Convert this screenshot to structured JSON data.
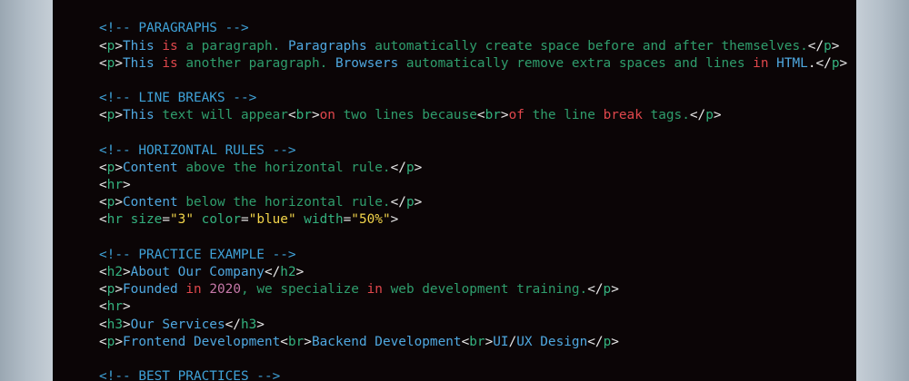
{
  "editor": {
    "lines": [
      [
        [
          "c-txt",
          "    "
        ]
      ],
      [],
      [
        [
          "c-comment",
          "<!-- PARAGRAPHS -->"
        ]
      ],
      [
        [
          "c-tag",
          "<"
        ],
        [
          "c-el",
          "p"
        ],
        [
          "c-tag",
          ">"
        ],
        [
          "c-blue",
          "This "
        ],
        [
          "c-kw",
          "is"
        ],
        [
          "c-txt",
          " a paragraph. "
        ],
        [
          "c-blue",
          "Paragraphs"
        ],
        [
          "c-txt",
          " automatically create space before and after themselves."
        ],
        [
          "c-tag",
          "</"
        ],
        [
          "c-el",
          "p"
        ],
        [
          "c-tag",
          ">"
        ]
      ],
      [
        [
          "c-tag",
          "<"
        ],
        [
          "c-el",
          "p"
        ],
        [
          "c-tag",
          ">"
        ],
        [
          "c-blue",
          "This "
        ],
        [
          "c-kw",
          "is"
        ],
        [
          "c-txt",
          " another paragraph. "
        ],
        [
          "c-blue",
          "Browsers"
        ],
        [
          "c-txt",
          " automatically remove extra spaces and lines "
        ],
        [
          "c-kw",
          "in"
        ],
        [
          "c-txt",
          " "
        ],
        [
          "c-blue",
          "HTML"
        ],
        [
          "c-tag",
          "."
        ],
        [
          "c-tag",
          "</"
        ],
        [
          "c-el",
          "p"
        ],
        [
          "c-tag",
          ">"
        ]
      ],
      [],
      [
        [
          "c-comment",
          "<!-- LINE BREAKS -->"
        ]
      ],
      [
        [
          "c-tag",
          "<"
        ],
        [
          "c-el",
          "p"
        ],
        [
          "c-tag",
          ">"
        ],
        [
          "c-blue",
          "This"
        ],
        [
          "c-txt",
          " text will appear"
        ],
        [
          "c-tag",
          "<"
        ],
        [
          "c-el",
          "br"
        ],
        [
          "c-tag",
          ">"
        ],
        [
          "c-kw",
          "on"
        ],
        [
          "c-txt",
          " two lines because"
        ],
        [
          "c-tag",
          "<"
        ],
        [
          "c-el",
          "br"
        ],
        [
          "c-tag",
          ">"
        ],
        [
          "c-kw",
          "of"
        ],
        [
          "c-txt",
          " the line "
        ],
        [
          "c-kw",
          "break"
        ],
        [
          "c-txt",
          " tags."
        ],
        [
          "c-tag",
          "</"
        ],
        [
          "c-el",
          "p"
        ],
        [
          "c-tag",
          ">"
        ]
      ],
      [],
      [
        [
          "c-comment",
          "<!-- HORIZONTAL RULES -->"
        ]
      ],
      [
        [
          "c-tag",
          "<"
        ],
        [
          "c-el",
          "p"
        ],
        [
          "c-tag",
          ">"
        ],
        [
          "c-blue",
          "Content"
        ],
        [
          "c-txt",
          " above the horizontal rule."
        ],
        [
          "c-tag",
          "</"
        ],
        [
          "c-el",
          "p"
        ],
        [
          "c-tag",
          ">"
        ]
      ],
      [
        [
          "c-tag",
          "<"
        ],
        [
          "c-el",
          "hr"
        ],
        [
          "c-tag",
          ">"
        ]
      ],
      [
        [
          "c-tag",
          "<"
        ],
        [
          "c-el",
          "p"
        ],
        [
          "c-tag",
          ">"
        ],
        [
          "c-blue",
          "Content"
        ],
        [
          "c-txt",
          " below the horizontal rule."
        ],
        [
          "c-tag",
          "</"
        ],
        [
          "c-el",
          "p"
        ],
        [
          "c-tag",
          ">"
        ]
      ],
      [
        [
          "c-tag",
          "<"
        ],
        [
          "c-el",
          "hr"
        ],
        [
          "c-attr",
          " size"
        ],
        [
          "c-tag",
          "="
        ],
        [
          "c-str",
          "\"3\""
        ],
        [
          "c-attr",
          " color"
        ],
        [
          "c-tag",
          "="
        ],
        [
          "c-str",
          "\"blue\""
        ],
        [
          "c-attr",
          " width"
        ],
        [
          "c-tag",
          "="
        ],
        [
          "c-str",
          "\"50%\""
        ],
        [
          "c-tag",
          ">"
        ]
      ],
      [],
      [
        [
          "c-comment",
          "<!-- PRACTICE EXAMPLE -->"
        ]
      ],
      [
        [
          "c-tag",
          "<"
        ],
        [
          "c-el",
          "h2"
        ],
        [
          "c-tag",
          ">"
        ],
        [
          "c-blue",
          "About Our Company"
        ],
        [
          "c-tag",
          "</"
        ],
        [
          "c-el",
          "h2"
        ],
        [
          "c-tag",
          ">"
        ]
      ],
      [
        [
          "c-tag",
          "<"
        ],
        [
          "c-el",
          "p"
        ],
        [
          "c-tag",
          ">"
        ],
        [
          "c-blue",
          "Founded"
        ],
        [
          "c-txt",
          " "
        ],
        [
          "c-kw",
          "in"
        ],
        [
          "c-txt",
          " "
        ],
        [
          "c-num",
          "2020"
        ],
        [
          "c-txt",
          ", we specialize "
        ],
        [
          "c-kw",
          "in"
        ],
        [
          "c-txt",
          " web development training."
        ],
        [
          "c-tag",
          "</"
        ],
        [
          "c-el",
          "p"
        ],
        [
          "c-tag",
          ">"
        ]
      ],
      [
        [
          "c-tag",
          "<"
        ],
        [
          "c-el",
          "hr"
        ],
        [
          "c-tag",
          ">"
        ]
      ],
      [
        [
          "c-tag",
          "<"
        ],
        [
          "c-el",
          "h3"
        ],
        [
          "c-tag",
          ">"
        ],
        [
          "c-blue",
          "Our Services"
        ],
        [
          "c-tag",
          "</"
        ],
        [
          "c-el",
          "h3"
        ],
        [
          "c-tag",
          ">"
        ]
      ],
      [
        [
          "c-tag",
          "<"
        ],
        [
          "c-el",
          "p"
        ],
        [
          "c-tag",
          ">"
        ],
        [
          "c-blue",
          "Frontend Development"
        ],
        [
          "c-tag",
          "<"
        ],
        [
          "c-el",
          "br"
        ],
        [
          "c-tag",
          ">"
        ],
        [
          "c-blue",
          "Backend Development"
        ],
        [
          "c-tag",
          "<"
        ],
        [
          "c-el",
          "br"
        ],
        [
          "c-tag",
          ">"
        ],
        [
          "c-blue",
          "UI"
        ],
        [
          "c-tag",
          "/"
        ],
        [
          "c-blue",
          "UX Design"
        ],
        [
          "c-tag",
          "</"
        ],
        [
          "c-el",
          "p"
        ],
        [
          "c-tag",
          ">"
        ]
      ],
      [],
      [
        [
          "c-comment",
          "<!-- BEST PRACTICES -->"
        ]
      ]
    ]
  }
}
